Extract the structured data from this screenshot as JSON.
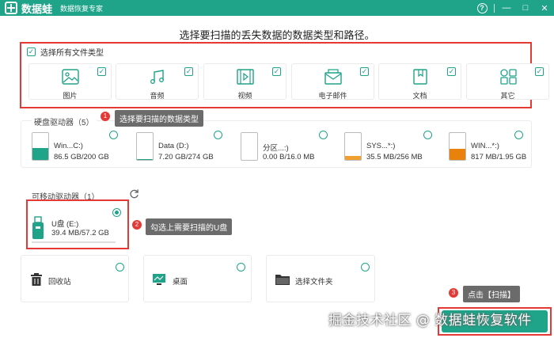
{
  "app": {
    "name": "数据蛙",
    "subtitle": "数据恢复专家"
  },
  "window_controls": {
    "help": "?",
    "minimize": "—",
    "maximize": "□",
    "close": "✕"
  },
  "heading": "选择要扫描的丢失数据的数据类型和路径。",
  "file_types": {
    "select_all_label": "选择所有文件类型",
    "select_all_checked": true,
    "items": [
      {
        "label": "图片",
        "icon": "image-icon",
        "checked": true
      },
      {
        "label": "音频",
        "icon": "audio-icon",
        "checked": true
      },
      {
        "label": "视频",
        "icon": "video-icon",
        "checked": true
      },
      {
        "label": "电子邮件",
        "icon": "email-icon",
        "checked": true
      },
      {
        "label": "文档",
        "icon": "document-icon",
        "checked": true
      },
      {
        "label": "其它",
        "icon": "other-icon",
        "checked": true
      }
    ]
  },
  "callouts": [
    {
      "number": "1",
      "text": "选择要扫描的数据类型"
    },
    {
      "number": "2",
      "text": "勾选上需要扫描的U盘"
    },
    {
      "number": "3",
      "text": "点击【扫描】"
    }
  ],
  "hard_drives": {
    "label": "硬盘驱动器（5）",
    "items": [
      {
        "name": "Win...C:)",
        "size": "86.5 GB/200 GB",
        "fill_fraction": 0.43,
        "fill_color": "#1fa389"
      },
      {
        "name": "Data (D:)",
        "size": "7.20 GB/274 GB",
        "fill_fraction": 0.03,
        "fill_color": "#1fa389"
      },
      {
        "name": "分区...:)",
        "size": "0.00  B/16.0 MB",
        "fill_fraction": 0.0,
        "fill_color": "#f0a030"
      },
      {
        "name": "SYS...*:)",
        "size": "35.5 MB/256 MB",
        "fill_fraction": 0.14,
        "fill_color": "#f0a030"
      },
      {
        "name": "WIN...*:)",
        "size": "817 MB/1.95 GB",
        "fill_fraction": 0.42,
        "fill_color": "#e8820c"
      }
    ]
  },
  "removable": {
    "label": "可移动驱动器（1）",
    "refresh_icon": "refresh-icon",
    "drive": {
      "name": "U盘 (E:)",
      "size": "39.4 MB/57.2 GB",
      "selected": true
    }
  },
  "locations": [
    {
      "label": "回收站",
      "icon": "recycle-bin-icon"
    },
    {
      "label": "桌面",
      "icon": "desktop-icon"
    },
    {
      "label": "选择文件夹",
      "icon": "folder-icon"
    }
  ],
  "watermark": "掘金技术社区 @ 数据蛙恢复软件",
  "colors": {
    "accent": "#1fa389",
    "highlight": "#e53935",
    "callout_bg": "#6b6b6b"
  }
}
